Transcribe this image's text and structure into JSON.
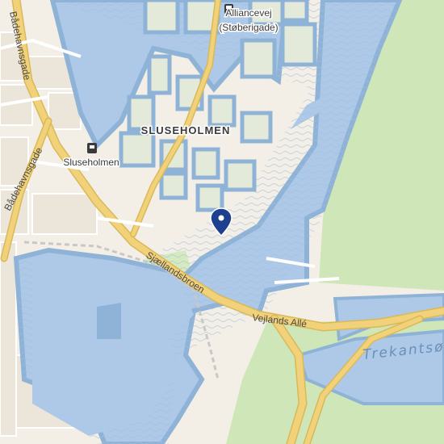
{
  "map": {
    "labels": {
      "sluseholmen_area": "SLUSEHOLMEN",
      "sluseholmen_station": "Sluseholmen",
      "alliancevej_stop": "Alliancevej",
      "stoberigade": "(Støberigade)",
      "baadehavnsgade": "Bådehavnsgade",
      "sjaellandsbroen": "Sjællandsbroen",
      "vejlands_alle": "Vejlands Allé",
      "trekantso": "Trekantsø"
    },
    "icons": {
      "location_pin": "map-marker-icon",
      "train": "train-station-icon",
      "bus": "bus-stop-icon"
    },
    "colors": {
      "water": "#aec9e8",
      "water_edge": "#8fb3d6",
      "land": "#f3efe6",
      "park": "#cfe6b8",
      "major_road": "#f1d27a",
      "pin": "#1f3f8f"
    }
  }
}
